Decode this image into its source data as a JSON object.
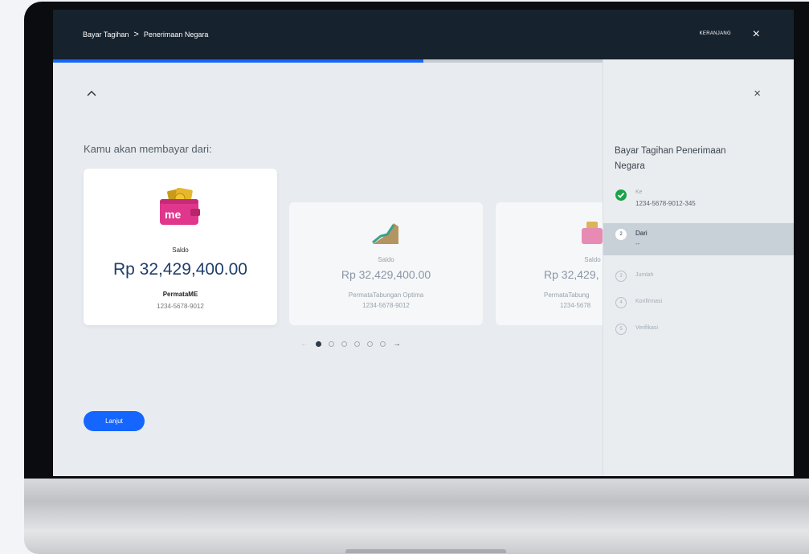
{
  "header": {
    "breadcrumb_parent": "Bayar Tagihan",
    "breadcrumb_separator": ">",
    "breadcrumb_current": "Penerimaan Negara",
    "cart_label": "KERANJANG",
    "close_glyph": "×"
  },
  "progress": {
    "fraction": 0.5
  },
  "main": {
    "heading": "Kamu akan membayar dari:",
    "accounts": [
      {
        "label": "Saldo",
        "amount": "Rp 32,429,400.00",
        "name": "PermataME",
        "number": "1234-5678-9012",
        "icon": "wallet-icon"
      },
      {
        "label": "Saldo",
        "amount": "Rp 32,429,400.00",
        "name": "PermataTabungan Optima",
        "number": "1234-5678-9012",
        "icon": "growth-chart-icon"
      },
      {
        "label": "Saldo",
        "amount": "Rp 32,429,",
        "name": "PermataTabung",
        "number": "1234-5678",
        "icon": "wallet-icon"
      }
    ],
    "pagination": {
      "total": 6,
      "current": 1,
      "prev_glyph": "←",
      "next_glyph": "→"
    },
    "next_button": "Lanjut"
  },
  "side_panel": {
    "close_glyph": "×",
    "title": "Bayar Tagihan Penerimaan Negara",
    "steps": [
      {
        "number": "1",
        "label": "Ke",
        "detail": "1234-5678-9012-345",
        "status": "done"
      },
      {
        "number": "2",
        "label": "Dari",
        "detail": "--",
        "status": "active"
      },
      {
        "number": "3",
        "label": "Jumlah",
        "detail": "",
        "status": "pending"
      },
      {
        "number": "4",
        "label": "Konfirmasi",
        "detail": "",
        "status": "pending"
      },
      {
        "number": "5",
        "label": "Verifikasi",
        "detail": "",
        "status": "pending"
      }
    ]
  },
  "colors": {
    "accent": "#1565ff",
    "topbar": "#16222d",
    "done": "#1aa34a",
    "active_row": "#c8d0d8"
  }
}
